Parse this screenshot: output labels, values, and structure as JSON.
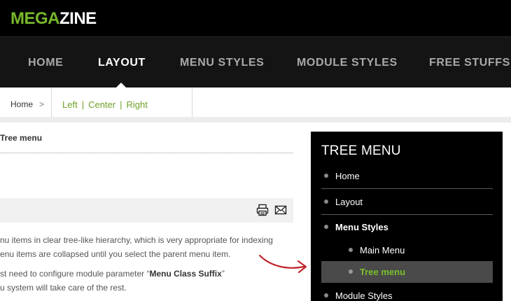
{
  "header": {
    "logo_part1": "MEGA",
    "logo_part2": "ZINE"
  },
  "nav": {
    "items": [
      {
        "label": "HOME"
      },
      {
        "label": "LAYOUT",
        "active": true
      },
      {
        "label": "MENU STYLES"
      },
      {
        "label": "MODULE STYLES"
      },
      {
        "label": "FREE STUFFS"
      }
    ]
  },
  "breadcrumb": {
    "home": "Home",
    "chevron": ">",
    "links": [
      "Left",
      "Center",
      "Right"
    ],
    "separator": "|"
  },
  "article": {
    "title": "Tree menu",
    "paragraphs": [
      "nu items in clear tree-like hierarchy, which is very appropriate for indexing",
      "enu items are collapsed until you select the parent menu item.",
      "st need to configure module parameter “",
      "Menu Class Suffix",
      "”",
      "u system will take care of the rest."
    ],
    "icons": [
      "print-icon",
      "email-icon"
    ]
  },
  "module": {
    "title": "TREE MENU",
    "items": [
      {
        "label": "Home"
      },
      {
        "label": "Layout"
      },
      {
        "label": "Menu Styles"
      },
      {
        "label": "Main Menu"
      },
      {
        "label": "Tree menu"
      },
      {
        "label": "Module Styles"
      }
    ]
  },
  "colors": {
    "accent_green": "#76b82a",
    "header_bg": "#000000",
    "nav_bg": "#141414",
    "module_bg": "#000000",
    "arrow_red": "#c0272d"
  }
}
